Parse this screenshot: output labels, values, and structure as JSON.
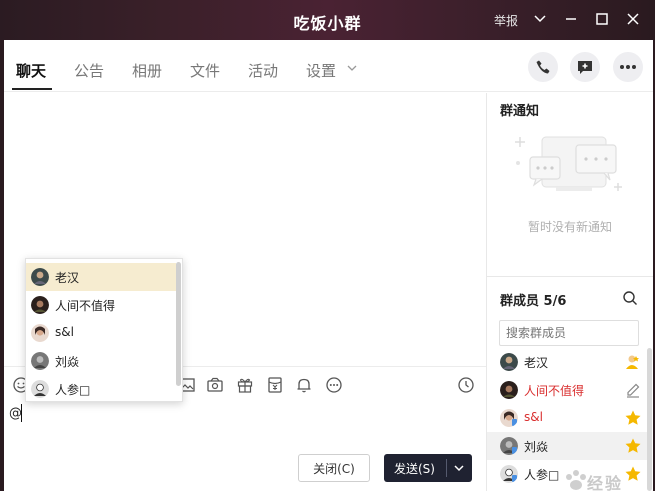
{
  "window": {
    "title": "吃饭小群",
    "report_label": "举报"
  },
  "tabs": [
    {
      "label": "聊天",
      "active": true
    },
    {
      "label": "公告"
    },
    {
      "label": "相册"
    },
    {
      "label": "文件"
    },
    {
      "label": "活动"
    },
    {
      "label": "设置"
    }
  ],
  "header_icons": [
    "phone-icon",
    "add-chat-icon",
    "more-icon"
  ],
  "toolbar_icons": [
    "emoji-icon",
    "image-icon",
    "screenshot-icon",
    "gift-icon",
    "red-packet-icon",
    "bell-icon",
    "more-options-icon",
    "history-clock-icon"
  ],
  "input": {
    "text": "@"
  },
  "mention_list": {
    "items": [
      {
        "name": "老汉",
        "selected": true
      },
      {
        "name": "人间不值得"
      },
      {
        "name": "s&l"
      },
      {
        "name": "刘焱"
      },
      {
        "name": "人参□"
      }
    ]
  },
  "buttons": {
    "close": "关闭(C)",
    "send": "发送(S)"
  },
  "notice": {
    "title": "群通知",
    "empty_text": "暂时没有新通知"
  },
  "members": {
    "title": "群成员 5/6",
    "search_placeholder": "搜索群成员",
    "items": [
      {
        "name": "老汉",
        "role_icon": "owner-icon"
      },
      {
        "name": "人间不值得",
        "role_icon": "edit-icon",
        "name_color": "#d92d2d"
      },
      {
        "name": "s&l",
        "role_icon": "star-icon",
        "name_color": "#d92d2d"
      },
      {
        "name": "刘焱",
        "role_icon": "star-icon"
      },
      {
        "name": "人参□",
        "role_icon": "star-icon"
      }
    ]
  },
  "watermark": {
    "text": "经验"
  },
  "colors": {
    "send_button": "#1f2231",
    "selected_mention": "#f6ecd0",
    "admin_name": "#d92d2d",
    "star": "#f5b800"
  }
}
